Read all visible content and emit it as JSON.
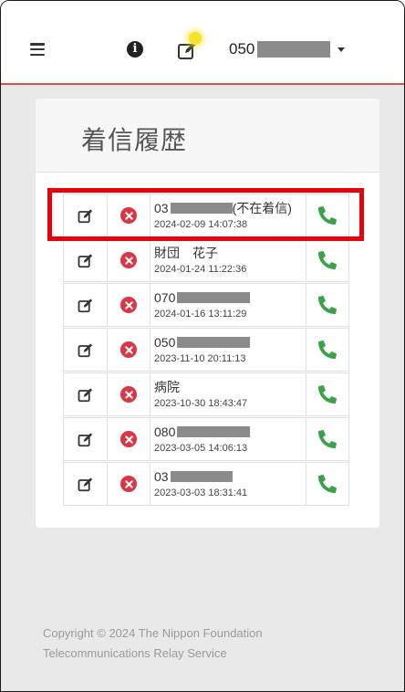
{
  "header": {
    "phone_number_prefix": "050",
    "menu_icon": "hamburger-menu-icon",
    "info_icon": "info-circle-icon",
    "edit_icon": "edit-icon",
    "dropdown_icon": "caret-down-icon"
  },
  "card": {
    "title": "着信履歴"
  },
  "history": [
    {
      "caller": "03",
      "masked": true,
      "suffix": " (不在着信)",
      "timestamp": "2024-02-09 14:07:38"
    },
    {
      "caller": "財団　花子",
      "masked": false,
      "suffix": "",
      "timestamp": "2024-01-24 11:22:36"
    },
    {
      "caller": "070",
      "masked": true,
      "suffix": "",
      "timestamp": "2024-01-16 13:11:29"
    },
    {
      "caller": "050",
      "masked": true,
      "suffix": "",
      "timestamp": "2023-11-10 20:11:13"
    },
    {
      "caller": "病院",
      "masked": false,
      "suffix": "",
      "timestamp": "2023-10-30 18:43:47"
    },
    {
      "caller": "080",
      "masked": true,
      "suffix": "",
      "timestamp": "2023-03-05 14:06:13"
    },
    {
      "caller": "03",
      "masked": true,
      "suffix": "",
      "timestamp": "2023-03-03 18:31:41"
    }
  ],
  "row_icons": {
    "edit": "edit-icon",
    "delete": "times-circle-icon",
    "call": "phone-icon"
  },
  "footer": {
    "line1": "Copyright © 2024 The Nippon Foundation",
    "line2": "Telecommunications Relay Service"
  },
  "colors": {
    "accent_red": "#d9534f",
    "delete_red": "#dc3545",
    "call_green": "#3aa34a",
    "highlight": "#e8000b",
    "notification_dot": "#f7e22a"
  }
}
